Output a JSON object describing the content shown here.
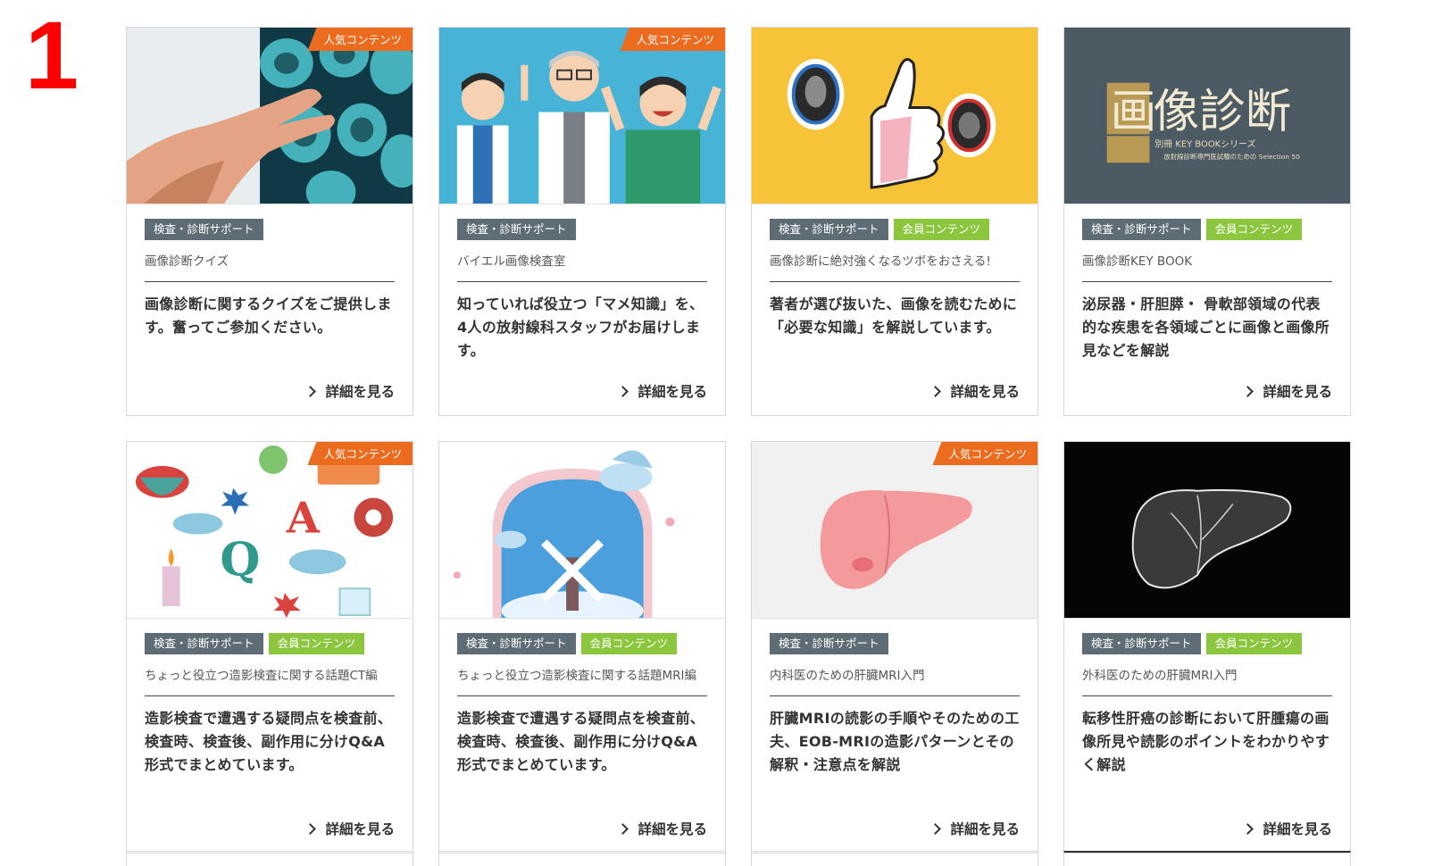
{
  "page_number": "1",
  "more_label": "詳細を見る",
  "popular_label": "人気コンテンツ",
  "colors": {
    "popular_badge": "#ec6c1f",
    "category_tag": "#5e6c75",
    "member_tag": "#8cc63f",
    "page_number": "#ff0000"
  },
  "cards": [
    {
      "image_icon": "xray-hand-image",
      "popular": true,
      "tags": [
        "検査・診断サポート"
      ],
      "member": false,
      "subtitle": "画像診断クイズ",
      "description": "画像診断に関するクイズをご提供します。奮ってご参加ください。"
    },
    {
      "image_icon": "doctors-illustration-image",
      "popular": true,
      "tags": [
        "検査・診断サポート"
      ],
      "member": false,
      "subtitle": "バイエル画像検査室",
      "description": "知っていれば役立つ「マメ知識」を、4人の放射線科スタッフがお届けします。"
    },
    {
      "image_icon": "thumbs-up-image",
      "popular": false,
      "tags": [
        "検査・診断サポート",
        "会員コンテンツ"
      ],
      "member": true,
      "subtitle": "画像診断に絶対強くなるツボをおさえる!",
      "description": "著者が選び抜いた、画像を読むために「必要な知識」を解説しています。"
    },
    {
      "image_icon": "book-cover-image",
      "popular": false,
      "tags": [
        "検査・診断サポート",
        "会員コンテンツ"
      ],
      "member": true,
      "subtitle": "画像診断KEY BOOK",
      "description": "泌尿器・肝胆膵・ 骨軟部領域の代表的な疾患を各領域ごとに画像と画像所見などを解説",
      "book_title": "画像診断",
      "book_sub": "別冊 KEY BOOKシリーズ",
      "book_caption": "放射線診断専門医試験のための Selection 50"
    },
    {
      "image_icon": "qa-illustration-image",
      "popular": true,
      "tags": [
        "検査・診断サポート",
        "会員コンテンツ"
      ],
      "member": true,
      "subtitle": "ちょっと役立つ造影検査に関する話題CT編",
      "description": "造影検査で遭遇する疑問点を検査前、検査時、検査後、副作用に分けQ&A形式でまとめています。"
    },
    {
      "image_icon": "windmill-illustration-image",
      "popular": false,
      "tags": [
        "検査・診断サポート",
        "会員コンテンツ"
      ],
      "member": true,
      "subtitle": "ちょっと役立つ造影検査に関する話題MRI編",
      "description": "造影検査で遭遇する疑問点を検査前、検査時、検査後、副作用に分けQ&A形式でまとめています。"
    },
    {
      "image_icon": "liver-pink-image",
      "popular": true,
      "tags": [
        "検査・診断サポート"
      ],
      "member": false,
      "subtitle": "内科医のための肝臓MRI入門",
      "description": "肝臓MRIの読影の手順やそのための工夫、EOB-MRIの造影パターンとその解釈・注意点を解説"
    },
    {
      "image_icon": "liver-xray-image",
      "popular": false,
      "tags": [
        "検査・診断サポート",
        "会員コンテンツ"
      ],
      "member": true,
      "subtitle": "外科医のための肝臓MRI入門",
      "description": "転移性肝癌の診断において肝腫瘍の画像所見や読影のポイントをわかりやすく解説"
    }
  ]
}
